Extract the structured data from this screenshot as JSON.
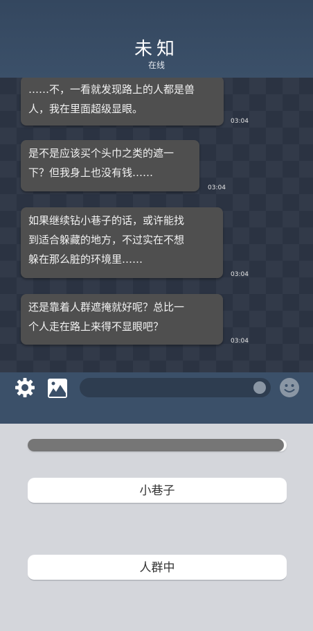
{
  "header": {
    "title": "未知",
    "status": "在线"
  },
  "messages": [
    {
      "lines": [
        "……不，一看就发现路上的人都是兽",
        "人，我在里面超级显眼。"
      ],
      "time": "03:04"
    },
    {
      "lines": [
        "是不是应该买个头巾之类的遮一",
        "下？但我身上也没有钱……"
      ],
      "time": "03:04"
    },
    {
      "lines": [
        "如果继续钻小巷子的话，或许能找",
        "到适合躲藏的地方，不过实在不想",
        "躲在那么脏的环境里……"
      ],
      "time": "03:04"
    },
    {
      "lines": [
        "还是靠着人群遮掩就好呢？总比一",
        "个人走在路上来得不显眼吧？"
      ],
      "time": "03:04"
    }
  ],
  "toolbar": {
    "icons": [
      "gear-icon",
      "image-icon",
      "smiley-icon"
    ]
  },
  "choices": {
    "progress_fraction": 0.99,
    "options": [
      "小巷子",
      "人群中"
    ]
  },
  "colors": {
    "header": "#3b5069",
    "bubble": "#4f4f4f",
    "chat_bg": "#2b3342",
    "panel": "#d4d6db"
  }
}
